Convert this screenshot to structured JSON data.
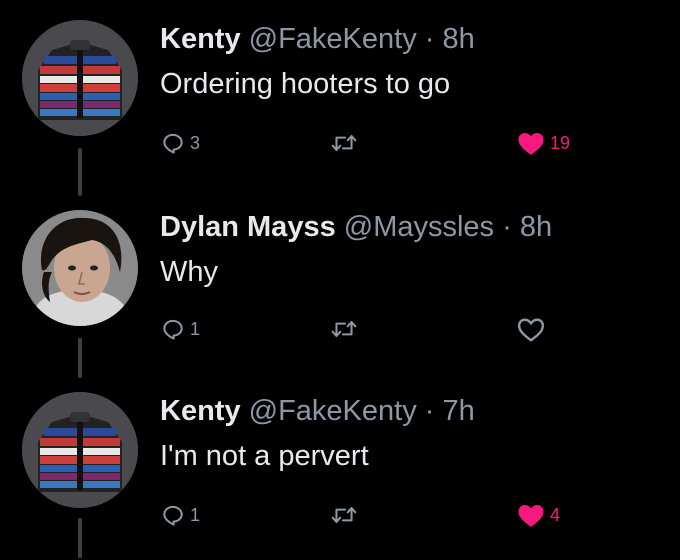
{
  "tweets": [
    {
      "name": "Kenty",
      "handle": "@FakeKenty",
      "separator": "·",
      "time": "8h",
      "text": "Ordering hooters to go",
      "reply_count": "3",
      "retweet_count": "",
      "like_count": "19",
      "liked": true,
      "avatar": "striped-jacket-avatar"
    },
    {
      "name": "Dylan Mayss",
      "handle": "@Mayssles",
      "separator": "·",
      "time": "8h",
      "text": "Why",
      "reply_count": "1",
      "retweet_count": "",
      "like_count": "",
      "liked": false,
      "avatar": "person-photo-avatar"
    },
    {
      "name": "Kenty",
      "handle": "@FakeKenty",
      "separator": "·",
      "time": "7h",
      "text": "I'm not a pervert",
      "reply_count": "1",
      "retweet_count": "",
      "like_count": "4",
      "liked": true,
      "avatar": "striped-jacket-avatar"
    }
  ],
  "colors": {
    "background": "#000000",
    "primary_text": "#e7e9ea",
    "secondary_text": "#8b98a5",
    "like_active": "#f91880",
    "thread_line": "#3b3f44"
  },
  "icons": {
    "reply": "reply-bubble-icon",
    "retweet": "retweet-arrows-icon",
    "like": "heart-icon"
  }
}
